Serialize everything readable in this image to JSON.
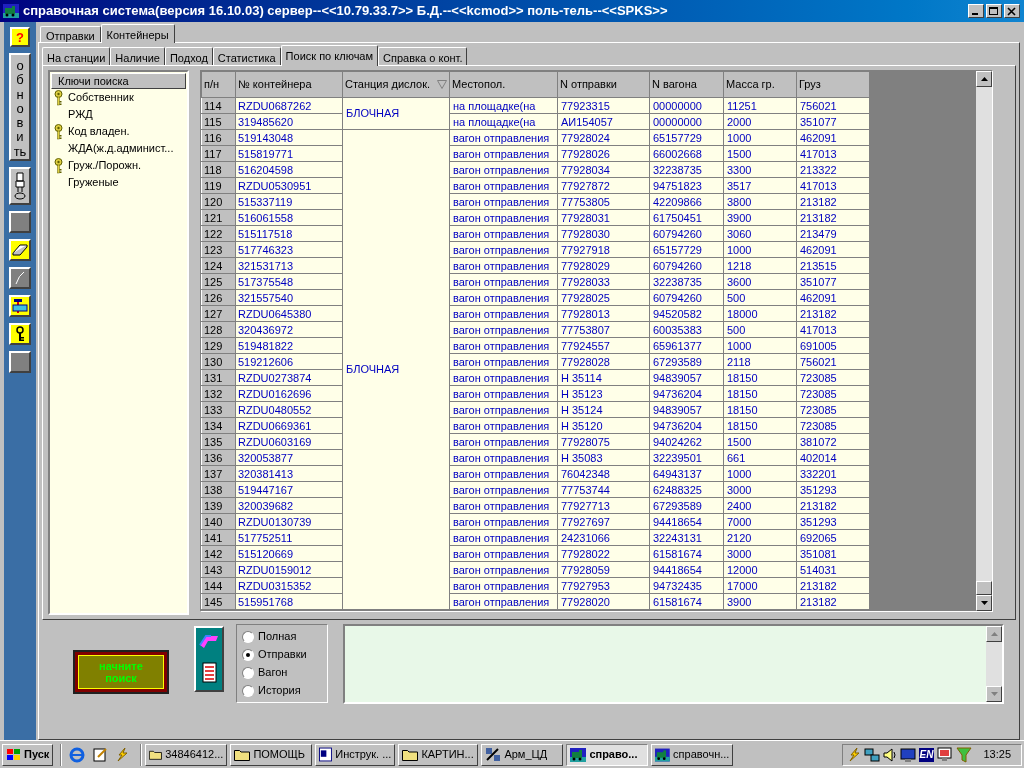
{
  "window": {
    "title": "справочная система(версия 16.10.03) сервер--<<10.79.33.7>> Б.Д.--<<kcmod>> поль-тель--<<SPKS>>"
  },
  "toolbar": {
    "help": "?",
    "refresh": "обновить"
  },
  "outer_tabs": [
    {
      "label": "Отправки",
      "selected": false
    },
    {
      "label": "Контейнеры",
      "selected": true
    }
  ],
  "inner_tabs": [
    {
      "label": "На станции",
      "selected": false
    },
    {
      "label": "Наличие",
      "selected": false
    },
    {
      "label": "Подход",
      "selected": false
    },
    {
      "label": "Статистика",
      "selected": false
    },
    {
      "label": "Поиск по ключам",
      "selected": true
    },
    {
      "label": "Справка о конт.",
      "selected": false
    }
  ],
  "search_keys": {
    "header": "Ключи поиска",
    "items": [
      {
        "kind": "key",
        "text": "Собственник"
      },
      {
        "kind": "value",
        "text": "РЖД"
      },
      {
        "kind": "key",
        "text": "Код владен."
      },
      {
        "kind": "value",
        "text": "ЖДА(ж.д.админист..."
      },
      {
        "kind": "key",
        "text": "Груж./Порожн."
      },
      {
        "kind": "value",
        "text": "Груженые"
      }
    ]
  },
  "table": {
    "columns": [
      "п/н",
      "№ контейнера",
      "Станция дислок.",
      "Местопол.",
      "N отправки",
      "N вагона",
      "Масса гр.",
      "Груз"
    ],
    "groups": [
      {
        "station": "БЛОЧНАЯ",
        "rows": [
          [
            "114",
            "RZDU0687262",
            "на площадке(на",
            "77923315",
            "00000000",
            "11251",
            "756021"
          ],
          [
            "115",
            "319485620",
            "на площадке(на",
            "АИ154057",
            "00000000",
            "2000",
            "351077"
          ]
        ]
      },
      {
        "station": "БЛОЧНАЯ",
        "rows": [
          [
            "116",
            "519143048",
            "вагон отправления",
            "77928024",
            "65157729",
            "1000",
            "462091"
          ],
          [
            "117",
            "515819771",
            "вагон отправления",
            "77928026",
            "66002668",
            "1500",
            "417013"
          ],
          [
            "118",
            "516204598",
            "вагон отправления",
            "77928034",
            "32238735",
            "3300",
            "213322"
          ],
          [
            "119",
            "RZDU0530951",
            "вагон отправления",
            "77927872",
            "94751823",
            "3517",
            "417013"
          ],
          [
            "120",
            "515337119",
            "вагон отправления",
            "77753805",
            "42209866",
            "3800",
            "213182"
          ],
          [
            "121",
            "516061558",
            "вагон отправления",
            "77928031",
            "61750451",
            "3900",
            "213182"
          ],
          [
            "122",
            "515117518",
            "вагон отправления",
            "77928030",
            "60794260",
            "3060",
            "213479"
          ],
          [
            "123",
            "517746323",
            "вагон отправления",
            "77927918",
            "65157729",
            "1000",
            "462091"
          ],
          [
            "124",
            "321531713",
            "вагон отправления",
            "77928029",
            "60794260",
            "1218",
            "213515"
          ],
          [
            "125",
            "517375548",
            "вагон отправления",
            "77928033",
            "32238735",
            "3600",
            "351077"
          ],
          [
            "126",
            "321557540",
            "вагон отправления",
            "77928025",
            "60794260",
            "500",
            "462091"
          ],
          [
            "127",
            "RZDU0645380",
            "вагон отправления",
            "77928013",
            "94520582",
            "18000",
            "213182"
          ],
          [
            "128",
            "320436972",
            "вагон отправления",
            "77753807",
            "60035383",
            "500",
            "417013"
          ],
          [
            "129",
            "519481822",
            "вагон отправления",
            "77924557",
            "65961377",
            "1000",
            "691005"
          ],
          [
            "130",
            "519212606",
            "вагон отправления",
            "77928028",
            "67293589",
            "2118",
            "756021"
          ],
          [
            "131",
            "RZDU0273874",
            "вагон отправления",
            "Н 35114",
            "94839057",
            "18150",
            "723085"
          ],
          [
            "132",
            "RZDU0162696",
            "вагон отправления",
            "Н 35123",
            "94736204",
            "18150",
            "723085"
          ],
          [
            "133",
            "RZDU0480552",
            "вагон отправления",
            "Н 35124",
            "94839057",
            "18150",
            "723085"
          ],
          [
            "134",
            "RZDU0669361",
            "вагон отправления",
            "Н 35120",
            "94736204",
            "18150",
            "723085"
          ],
          [
            "135",
            "RZDU0603169",
            "вагон отправления",
            "77928075",
            "94024262",
            "1500",
            "381072"
          ],
          [
            "136",
            "320053877",
            "вагон отправления",
            "Н 35083",
            "32239501",
            "661",
            "402014"
          ],
          [
            "137",
            "320381413",
            "вагон отправления",
            "76042348",
            "64943137",
            "1000",
            "332201"
          ],
          [
            "138",
            "519447167",
            "вагон отправления",
            "77753744",
            "62488325",
            "3000",
            "351293"
          ],
          [
            "139",
            "320039682",
            "вагон отправления",
            "77927713",
            "67293589",
            "2400",
            "213182"
          ],
          [
            "140",
            "RZDU0130739",
            "вагон отправления",
            "77927697",
            "94418654",
            "7000",
            "351293"
          ],
          [
            "141",
            "517752511",
            "вагон отправления",
            "24231066",
            "32243131",
            "2120",
            "692065"
          ],
          [
            "142",
            "515120669",
            "вагон отправления",
            "77928022",
            "61581674",
            "3000",
            "351081"
          ],
          [
            "143",
            "RZDU0159012",
            "вагон отправления",
            "77928059",
            "94418654",
            "12000",
            "514031"
          ],
          [
            "144",
            "RZDU0315352",
            "вагон отправления",
            "77927953",
            "94732435",
            "17000",
            "213182"
          ],
          [
            "145",
            "515951768",
            "вагон отправления",
            "77928020",
            "61581674",
            "3900",
            "213182"
          ]
        ]
      }
    ]
  },
  "search_button": "начните поиск",
  "mode_options": [
    {
      "label": "Полная",
      "selected": false
    },
    {
      "label": "Отправки",
      "selected": true
    },
    {
      "label": "Вагон",
      "selected": false
    },
    {
      "label": "История",
      "selected": false
    }
  ],
  "taskbar": {
    "start": "Пуск",
    "tasks": [
      {
        "kind": "folder",
        "label": "34846412...",
        "selected": false
      },
      {
        "kind": "folder",
        "label": "ПОМОЩЬ",
        "selected": false
      },
      {
        "kind": "document",
        "label": "Инструк. ...",
        "selected": false
      },
      {
        "kind": "folder",
        "label": "КАРТИН...",
        "selected": false
      },
      {
        "kind": "app",
        "label": "Арм_ЦД",
        "selected": false
      },
      {
        "kind": "train",
        "label": "справо...",
        "selected": true
      },
      {
        "kind": "train",
        "label": "справочн...",
        "selected": false
      }
    ],
    "language": "EN",
    "clock": "13:25"
  }
}
